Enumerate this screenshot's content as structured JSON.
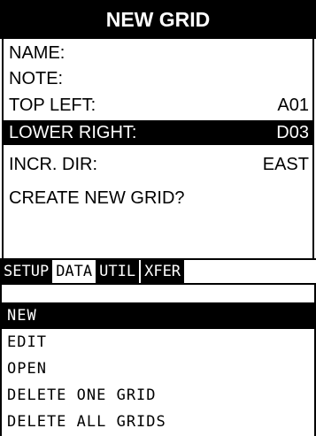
{
  "header": {
    "title": "NEW GRID"
  },
  "fields": [
    {
      "label": "NAME:",
      "value": "",
      "selected": false
    },
    {
      "label": "NOTE:",
      "value": "",
      "selected": false
    },
    {
      "label": "TOP LEFT:",
      "value": "A01",
      "selected": false
    },
    {
      "label": "LOWER RIGHT:",
      "value": "D03",
      "selected": true
    },
    {
      "label": "INCR. DIR:",
      "value": "EAST",
      "selected": false
    }
  ],
  "prompt": "CREATE NEW GRID?",
  "tabs": [
    {
      "label": "SETUP",
      "active": false
    },
    {
      "label": "DATA",
      "active": true
    },
    {
      "label": "UTIL",
      "active": false
    },
    {
      "label": "XFER",
      "active": false
    }
  ],
  "menu": [
    {
      "label": "NEW",
      "selected": true
    },
    {
      "label": "EDIT",
      "selected": false
    },
    {
      "label": "OPEN",
      "selected": false
    },
    {
      "label": "DELETE ONE GRID",
      "selected": false
    },
    {
      "label": "DELETE ALL GRIDS",
      "selected": false
    }
  ]
}
